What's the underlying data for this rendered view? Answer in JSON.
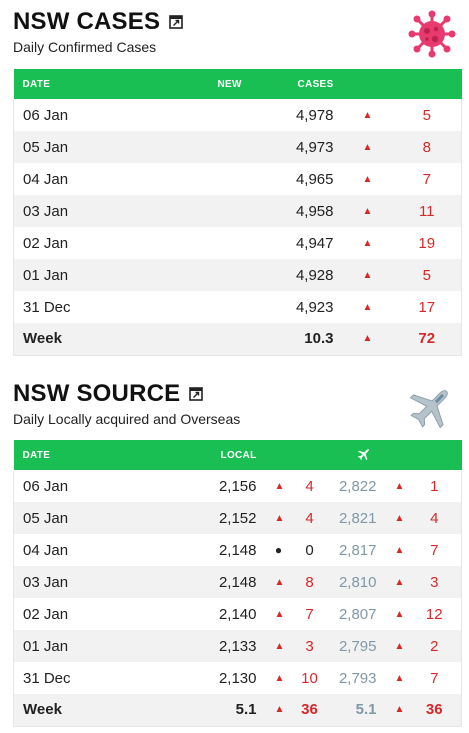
{
  "cases": {
    "title": "NSW CASES",
    "subtitle": "Daily Confirmed Cases",
    "headers": {
      "date": "DATE",
      "new": "NEW",
      "cases": "CASES"
    },
    "rows": [
      {
        "date": "06 Jan",
        "cases": "4,978",
        "change": "5"
      },
      {
        "date": "05 Jan",
        "cases": "4,973",
        "change": "8"
      },
      {
        "date": "04 Jan",
        "cases": "4,965",
        "change": "7"
      },
      {
        "date": "03 Jan",
        "cases": "4,958",
        "change": "11"
      },
      {
        "date": "02 Jan",
        "cases": "4,947",
        "change": "19"
      },
      {
        "date": "01 Jan",
        "cases": "4,928",
        "change": "5"
      },
      {
        "date": "31 Dec",
        "cases": "4,923",
        "change": "17"
      }
    ],
    "week": {
      "label": "Week",
      "cases": "10.3",
      "change": "72"
    }
  },
  "source": {
    "title": "NSW SOURCE",
    "subtitle": "Daily Locally acquired and Overseas",
    "headers": {
      "date": "DATE",
      "local": "LOCAL"
    },
    "rows": [
      {
        "date": "06 Jan",
        "local": "2,156",
        "local_change": "4",
        "local_dir": "up",
        "overseas": "2,822",
        "overseas_change": "1"
      },
      {
        "date": "05 Jan",
        "local": "2,152",
        "local_change": "4",
        "local_dir": "up",
        "overseas": "2,821",
        "overseas_change": "4"
      },
      {
        "date": "04 Jan",
        "local": "2,148",
        "local_change": "0",
        "local_dir": "none",
        "overseas": "2,817",
        "overseas_change": "7"
      },
      {
        "date": "03 Jan",
        "local": "2,148",
        "local_change": "8",
        "local_dir": "up",
        "overseas": "2,810",
        "overseas_change": "3"
      },
      {
        "date": "02 Jan",
        "local": "2,140",
        "local_change": "7",
        "local_dir": "up",
        "overseas": "2,807",
        "overseas_change": "12"
      },
      {
        "date": "01 Jan",
        "local": "2,133",
        "local_change": "3",
        "local_dir": "up",
        "overseas": "2,795",
        "overseas_change": "2"
      },
      {
        "date": "31 Dec",
        "local": "2,130",
        "local_change": "10",
        "local_dir": "up",
        "overseas": "2,793",
        "overseas_change": "7"
      }
    ],
    "week": {
      "label": "Week",
      "local": "5.1",
      "local_change": "36",
      "overseas": "5.1",
      "overseas_change": "36"
    }
  },
  "symbols": {
    "up": "▲",
    "none": "●"
  },
  "colors": {
    "header_green": "#19bf52",
    "increase_red": "#d62828",
    "overseas_gray_blue": "#7f98a8",
    "virus_pink": "#e83a6e"
  },
  "icons": {
    "expand": "expand-icon",
    "virus": "virus-icon",
    "plane": "plane-icon"
  }
}
